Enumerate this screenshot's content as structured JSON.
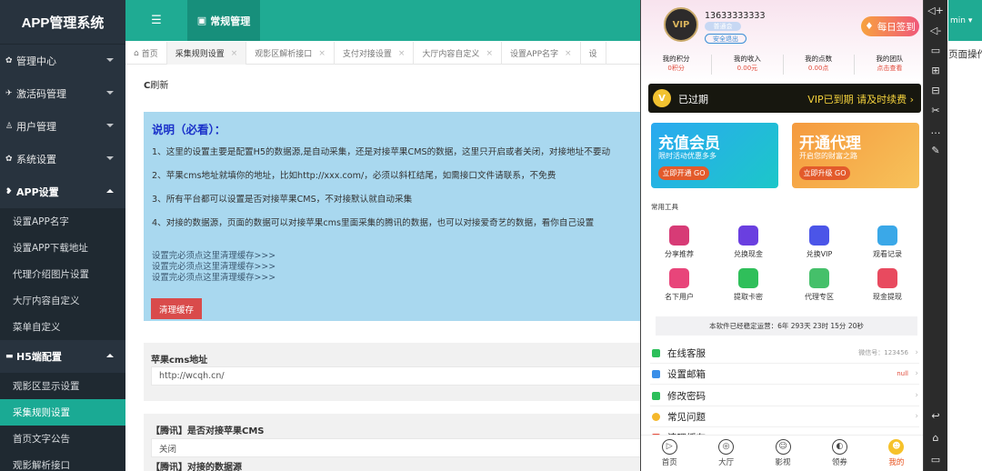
{
  "app_title": "APP管理系统",
  "header": {
    "toggle_icon": "☰",
    "active_tab": "常规管理"
  },
  "sidebar": {
    "menus": [
      {
        "label": "管理中心",
        "icon": "gear-icon"
      },
      {
        "label": "激活码管理",
        "icon": "plane-icon"
      },
      {
        "label": "用户管理",
        "icon": "user-icon"
      },
      {
        "label": "系统设置",
        "icon": "gear-icon"
      }
    ],
    "app_group": {
      "label": "APP设置",
      "items": [
        "设置APP名字",
        "设置APP下载地址",
        "代理介绍图片设置",
        "大厅内容自定义",
        "菜单自定义"
      ]
    },
    "h5_group": {
      "label": "H5端配置",
      "items": [
        "观影区显示设置",
        "采集规则设置",
        "首页文字公告",
        "观影解析接口"
      ]
    }
  },
  "tabs": [
    "首页",
    "采集规则设置",
    "观影区解析接口",
    "支付对接设置",
    "大厅内容自定义",
    "设置APP名字",
    "设"
  ],
  "content": {
    "refresh_label": "刷新",
    "notice_title": "说明（必看）：",
    "notice_lines": [
      "1、这里的设置主要是配置H5的数据源,是自动采集，还是对接苹果CMS的数据，这里只开启或者关闭，对接地址不要动",
      "2、苹果cms地址就填你的地址，比如http://xxx.com/，必须以斜杠结尾，如需接口文件请联系，不免费",
      "3、所有平台都可以设置是否对接苹果CMS，不对接默认就自动采集",
      "4、对接的数据源，页面的数据可以对接苹果cms里面采集的腾讯的数据，也可以对接爱奇艺的数据，看你自己设置"
    ],
    "cache_lines": [
      "设置完必须点这里清理缓存>>>",
      "设置完必须点这里清理缓存>>>",
      "设置完必须点这里清理缓存>>>"
    ],
    "clear_cache_button": "清理缓存",
    "cms_label": "苹果cms地址",
    "cms_value": "http://wcqh.cn/",
    "tencent_label": "【腾讯】是否对接苹果CMS",
    "tencent_value": "关闭",
    "tencent_src_label": "【腾讯】对接的数据源"
  },
  "phone": {
    "phone_number": "13633333333",
    "badge": "普通会",
    "logout": "安全退出",
    "avatar": "VIP",
    "checkin": "每日签到",
    "stats": [
      {
        "k": "我的积分",
        "v": "0积分"
      },
      {
        "k": "我的收入",
        "v": "0.00元"
      },
      {
        "k": "我的点数",
        "v": "0.00点"
      },
      {
        "k": "我的团队",
        "v": "点击查看"
      }
    ],
    "vip_left": "已过期",
    "vip_right": "VIP已到期 请及时续费",
    "banner1": {
      "title": "充值会员",
      "sub": "限时活动优惠多多",
      "btn": "立即开通 GO"
    },
    "banner2": {
      "title": "开通代理",
      "sub": "开启您的财富之路",
      "btn": "立即升级 GO"
    },
    "tools_title": "常用工具",
    "tools": [
      {
        "label": "分享推荐",
        "color": "#d73b76"
      },
      {
        "label": "兑换现金",
        "color": "#6a3fe0"
      },
      {
        "label": "兑换VIP",
        "color": "#4b55e8"
      },
      {
        "label": "观看记录",
        "color": "#3aa8e8"
      },
      {
        "label": "名下用户",
        "color": "#e8457a"
      },
      {
        "label": "提取卡密",
        "color": "#2fbf5a"
      },
      {
        "label": "代理专区",
        "color": "#45c06a"
      },
      {
        "label": "现金提现",
        "color": "#e84a5f"
      }
    ],
    "uptime": "本软件已经稳定运营：6年 293天 23时 15分 20秒",
    "list": [
      {
        "label": "在线客服",
        "right": "微信号：123456",
        "color": "#2cbf5a"
      },
      {
        "label": "设置邮箱",
        "right": "null",
        "color": "#3a8fe8"
      },
      {
        "label": "修改密码",
        "right": "",
        "color": "#2cbf5a"
      },
      {
        "label": "常见问题",
        "right": "",
        "color": "#f5b82b"
      },
      {
        "label": "清理缓存",
        "right": "",
        "color": "#e84a3a"
      }
    ],
    "tabbar": [
      "首页",
      "大厅",
      "影视",
      "领券",
      "我的"
    ]
  },
  "right_panel": {
    "top_text": "min ▾",
    "bottom_text": "页面操作"
  }
}
